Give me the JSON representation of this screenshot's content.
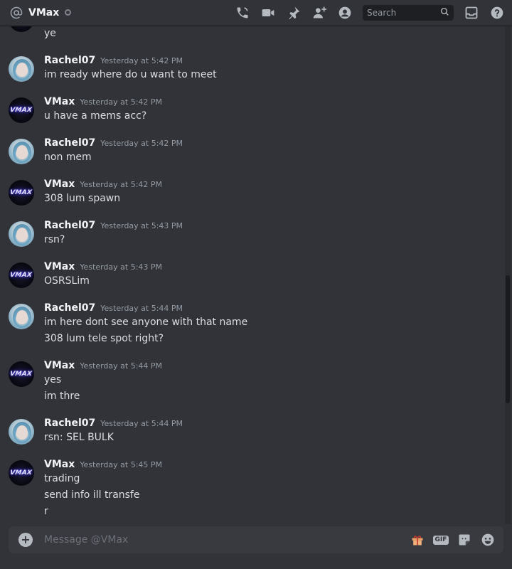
{
  "header": {
    "title": "VMax",
    "search_placeholder": "Search",
    "icons": [
      "at-icon",
      "status-dot",
      "voice-call-icon",
      "video-call-icon",
      "pin-icon",
      "add-friend-icon",
      "profile-icon",
      "search-icon",
      "inbox-icon",
      "help-icon"
    ]
  },
  "messages": [
    {
      "author": "",
      "timestamp": "",
      "lines": [
        "ye"
      ],
      "avatar": "vmax"
    },
    {
      "author": "Rachel07",
      "timestamp": "Yesterday at 5:42 PM",
      "lines": [
        "im ready where do u want to meet"
      ],
      "avatar": "rachel"
    },
    {
      "author": "VMax",
      "timestamp": "Yesterday at 5:42 PM",
      "lines": [
        "u have a mems acc?"
      ],
      "avatar": "vmax"
    },
    {
      "author": "Rachel07",
      "timestamp": "Yesterday at 5:42 PM",
      "lines": [
        "non mem"
      ],
      "avatar": "rachel"
    },
    {
      "author": "VMax",
      "timestamp": "Yesterday at 5:42 PM",
      "lines": [
        "308 lum spawn"
      ],
      "avatar": "vmax"
    },
    {
      "author": "Rachel07",
      "timestamp": "Yesterday at 5:43 PM",
      "lines": [
        "rsn?"
      ],
      "avatar": "rachel"
    },
    {
      "author": "VMax",
      "timestamp": "Yesterday at 5:43 PM",
      "lines": [
        "OSRSLim"
      ],
      "avatar": "vmax"
    },
    {
      "author": "Rachel07",
      "timestamp": "Yesterday at 5:44 PM",
      "lines": [
        "im here  dont see anyone with that name",
        "308 lum tele spot right?"
      ],
      "avatar": "rachel"
    },
    {
      "author": "VMax",
      "timestamp": "Yesterday at 5:44 PM",
      "lines": [
        "yes",
        "im thre"
      ],
      "avatar": "vmax"
    },
    {
      "author": "Rachel07",
      "timestamp": "Yesterday at 5:44 PM",
      "lines": [
        "rsn: SEL BULK"
      ],
      "avatar": "rachel"
    },
    {
      "author": "VMax",
      "timestamp": "Yesterday at 5:45 PM",
      "lines": [
        "trading",
        "send info ill transfe",
        "r"
      ],
      "avatar": "vmax"
    }
  ],
  "avatars": {
    "vmax_logo_text": "VMAX"
  },
  "composer": {
    "placeholder": "Message @VMax",
    "gif_label": "GIF"
  }
}
